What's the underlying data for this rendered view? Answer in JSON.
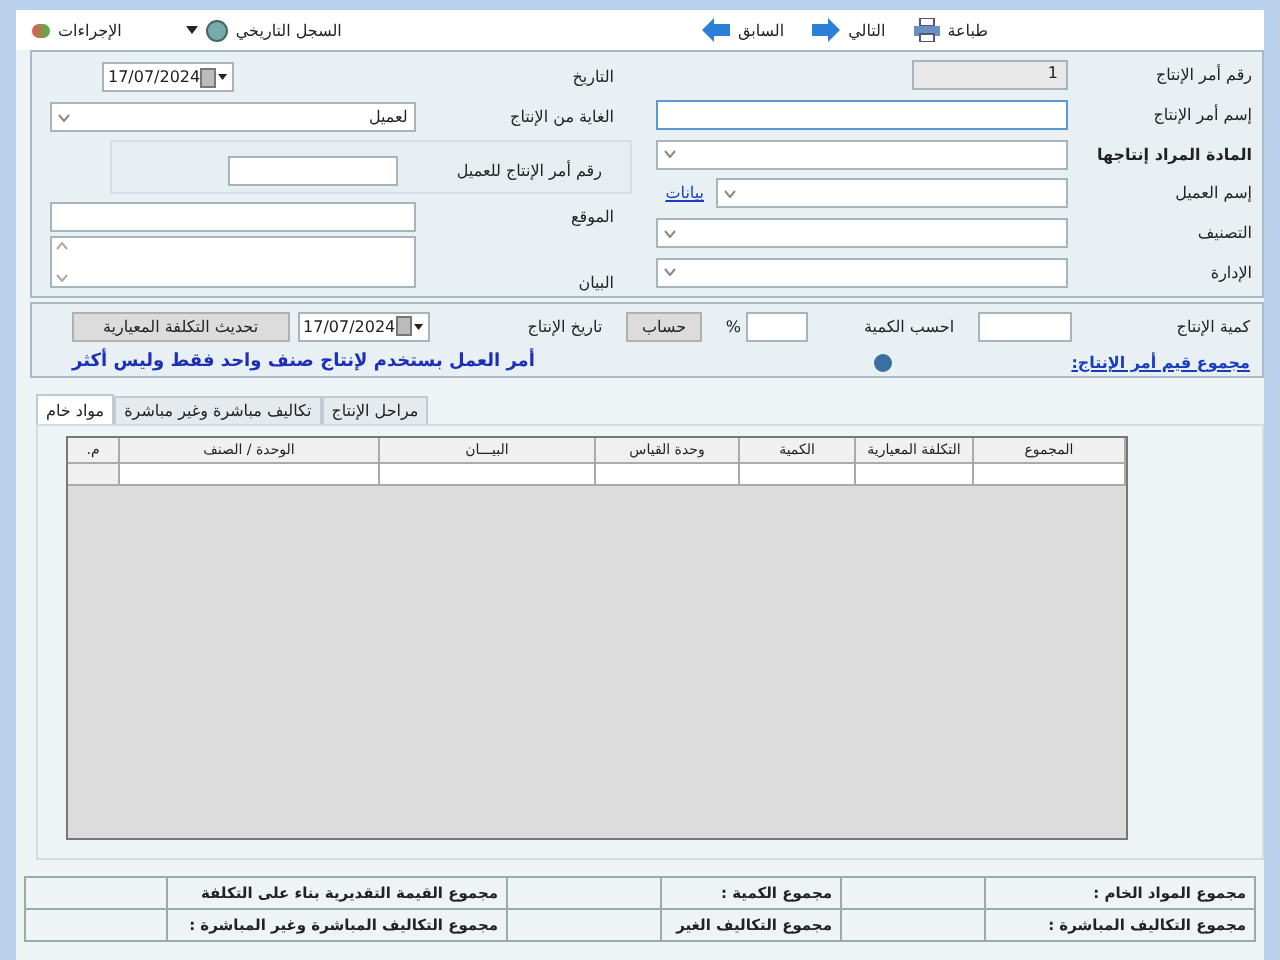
{
  "toolbar": {
    "actions": "الإجراءات",
    "history": "السجل التاريخي",
    "print": "طباعة",
    "next": "التالي",
    "previous": "السابق"
  },
  "header_form": {
    "order_number": {
      "label": "رقم أمر الإنتاج",
      "value": "1"
    },
    "order_name": {
      "label": "إسم أمر الإنتاج"
    },
    "product": {
      "label": "المادة المراد إنتاجها"
    },
    "customer": {
      "label": "إسم العميل",
      "link": "بيانات"
    },
    "category": {
      "label": "التصنيف"
    },
    "department": {
      "label": "الإدارة"
    },
    "date": {
      "label": "التاريخ",
      "value": "17/07/2024"
    },
    "purpose": {
      "label": "الغاية من الإنتاج",
      "value": "لعميل"
    },
    "customer_order_number": {
      "label": "رقم أمر الإنتاج للعميل"
    },
    "location": {
      "label": "الموقع"
    },
    "description": {
      "label": "البيان"
    }
  },
  "quantity_panel": {
    "quantity_label": "كمية الإنتاج",
    "calc_label": "احسب الكمية",
    "percent": "%",
    "calc_button": "حساب",
    "date_label": "تاريخ الإنتاج",
    "date_value": "17/07/2024",
    "update_button": "تحديث التكلفة المعيارية",
    "totals_link": "مجموع قيم أمر الإنتاج:",
    "note": "أمر العمل بستخدم لإنتاج صنف واحد فقط وليس أكثر"
  },
  "tabs": [
    {
      "label": "مراحل الإنتاج",
      "selected": false
    },
    {
      "label": "تكاليف مباشرة وغير مباشرة",
      "selected": false
    },
    {
      "label": "مواد خام",
      "selected": true
    }
  ],
  "grid": {
    "columns": [
      "المجموع",
      "التكلفة المعيارية",
      "الكمية",
      "وحدة القياس",
      "البيـــان",
      "الوحدة / الصنف",
      "م."
    ]
  },
  "totals": [
    {
      "label": "مجموع المواد الخام :"
    },
    {
      "label": "مجموع الكمية :"
    },
    {
      "label": "مجموع القيمة التقديرية بناء على التكلفة"
    },
    {
      "label": "مجموع التكاليف المباشرة :"
    },
    {
      "label": "مجموع التكاليف الغير"
    },
    {
      "label": "مجموع التكاليف المباشرة وغير المباشرة :"
    }
  ]
}
